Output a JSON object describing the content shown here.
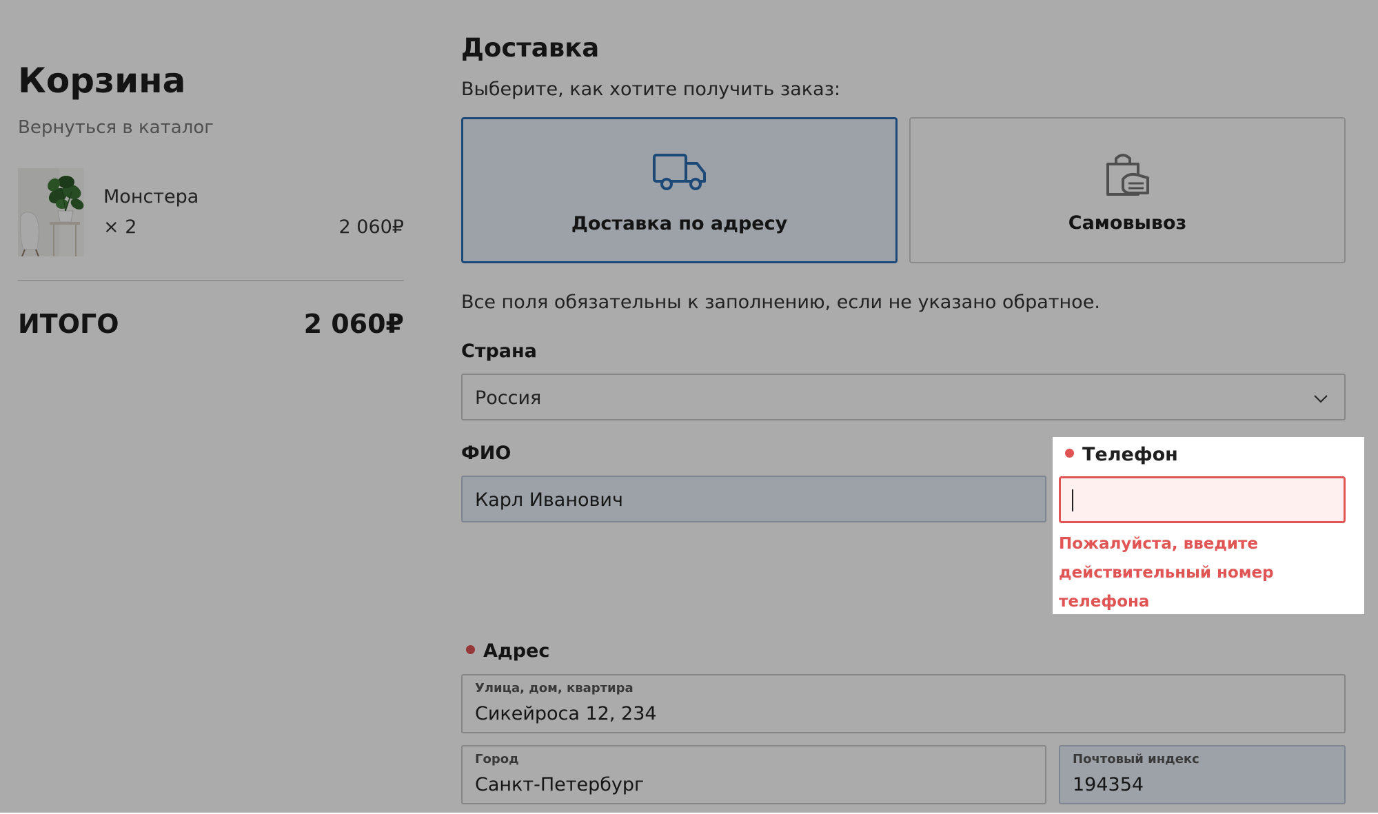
{
  "cart": {
    "title": "Корзина",
    "back_link": "Вернуться в каталог",
    "items": [
      {
        "name": "Монстера",
        "qty": "× 2",
        "price": "2 060₽"
      }
    ],
    "total_label": "ИТОГО",
    "total_value": "2 060₽"
  },
  "delivery": {
    "title": "Доставка",
    "subtitle": "Выберите, как хотите получить заказ:",
    "options": [
      {
        "label": "Доставка по адресу",
        "icon": "truck-icon",
        "selected": true
      },
      {
        "label": "Самовывоз",
        "icon": "shopping-bag-icon",
        "selected": false
      }
    ],
    "required_note": "Все поля обязательны к заполнению, если не указано обратное."
  },
  "form": {
    "country": {
      "label": "Страна",
      "value": "Россия"
    },
    "fio": {
      "label": "ФИО",
      "value": "Карл Иванович"
    },
    "phone": {
      "label": "Телефон",
      "value": "",
      "error": "Пожалуйста, введите действительный номер телефона"
    },
    "address": {
      "label": "Адрес",
      "street": {
        "label": "Улица, дом, квартира",
        "value": "Сикейроса 12, 234"
      },
      "city": {
        "label": "Город",
        "value": "Санкт-Петербург"
      },
      "zip": {
        "label": "Почтовый индекс",
        "value": "194354"
      }
    }
  },
  "colors": {
    "accent": "#2c6db3",
    "error": "#e05454",
    "filled_input_bg": "#eaf1fb"
  }
}
